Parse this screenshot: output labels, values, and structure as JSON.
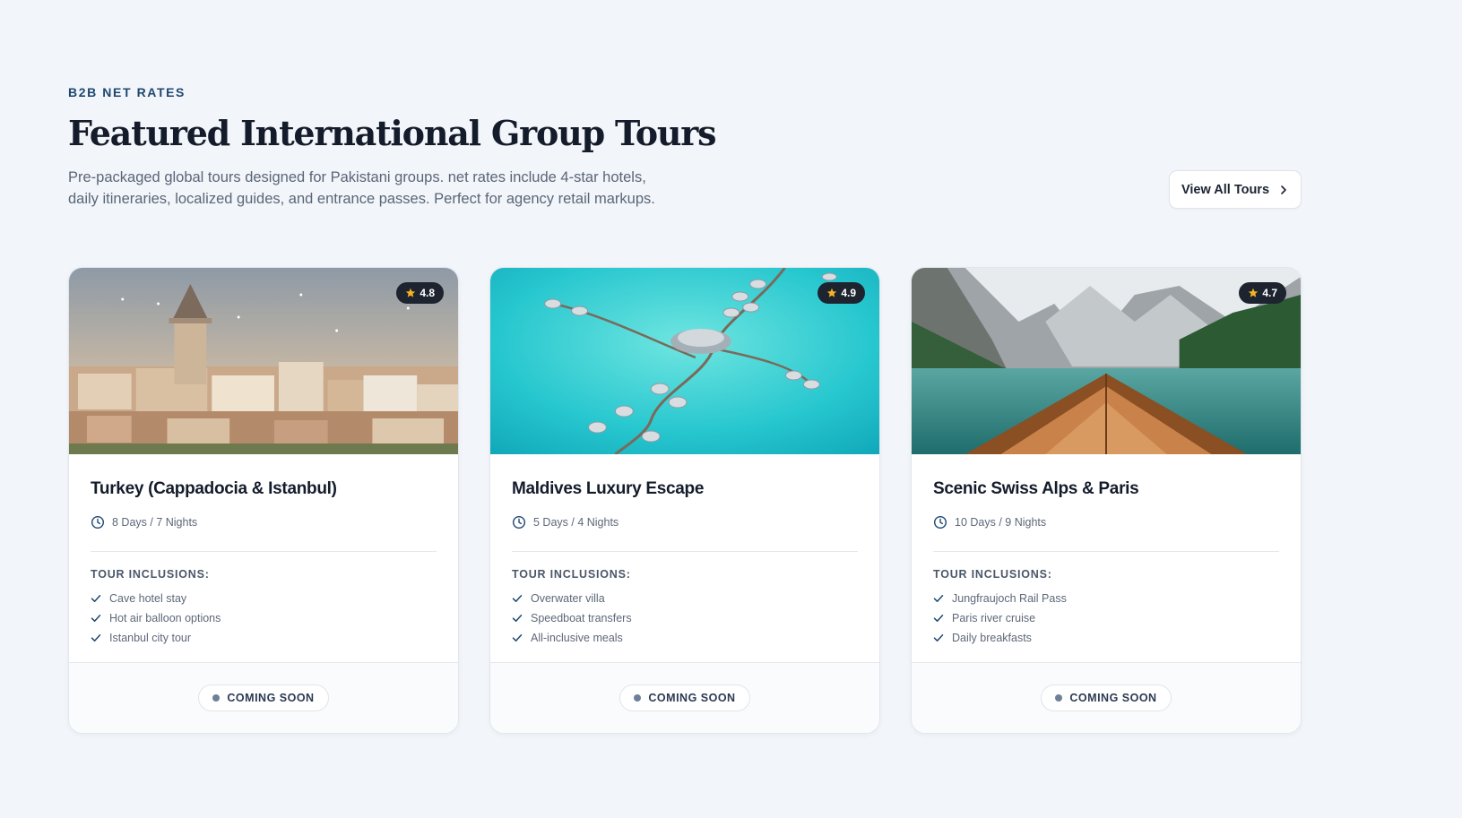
{
  "header": {
    "eyebrow": "B2B NET RATES",
    "title": "Featured International Group Tours",
    "description": "Pre-packaged global tours designed for Pakistani groups. net rates include 4-star hotels, daily itineraries, localized guides, and entrance passes. Perfect for agency retail markups.",
    "view_all_label": "View All Tours"
  },
  "colors": {
    "background": "#f2f5f9",
    "eyebrow": "#1e4770",
    "rating_bg": "#1d2430",
    "star": "#f5b324",
    "badge_dot": "#6e7f98"
  },
  "tours": [
    {
      "title": "Turkey (Cappadocia & Istanbul)",
      "rating": "4.8",
      "duration": "8 Days / 7 Nights",
      "inclusions_title": "TOUR INCLUSIONS:",
      "inclusions": [
        "Cave hotel stay",
        "Hot air balloon options",
        "Istanbul city tour"
      ],
      "status": "COMING SOON",
      "image_icon": "istanbul-galata-tower-photo"
    },
    {
      "title": "Maldives Luxury Escape",
      "rating": "4.9",
      "duration": "5 Days / 4 Nights",
      "inclusions_title": "TOUR INCLUSIONS:",
      "inclusions": [
        "Overwater villa",
        "Speedboat transfers",
        "All-inclusive meals"
      ],
      "status": "COMING SOON",
      "image_icon": "maldives-overwater-villas-photo"
    },
    {
      "title": "Scenic Swiss Alps & Paris",
      "rating": "4.7",
      "duration": "10 Days / 9 Nights",
      "inclusions_title": "TOUR INCLUSIONS:",
      "inclusions": [
        "Jungfraujoch Rail Pass",
        "Paris river cruise",
        "Daily breakfasts"
      ],
      "status": "COMING SOON",
      "image_icon": "alpine-lake-boat-photo"
    }
  ]
}
